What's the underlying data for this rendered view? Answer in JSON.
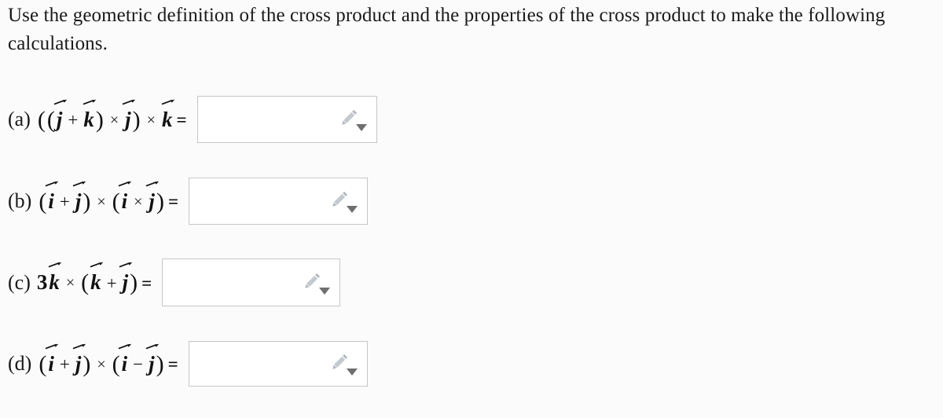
{
  "prompt": {
    "text": "Use the geometric definition of the cross product and the properties of the cross product to make the following calculations."
  },
  "questions": [
    {
      "id": "a",
      "label": "(a)",
      "expression_plain": "((j⃗ + k⃗) × j⃗) × k⃗ =",
      "tokens": [
        {
          "t": "paren",
          "v": "("
        },
        {
          "t": "paren",
          "v": "("
        },
        {
          "t": "vec",
          "v": "j"
        },
        {
          "t": "plus",
          "v": "+"
        },
        {
          "t": "vec",
          "v": "k"
        },
        {
          "t": "paren",
          "v": ")"
        },
        {
          "t": "times",
          "v": "×"
        },
        {
          "t": "vec",
          "v": "j"
        },
        {
          "t": "paren",
          "v": ")"
        },
        {
          "t": "times",
          "v": "×"
        },
        {
          "t": "vec",
          "v": "k"
        },
        {
          "t": "eq",
          "v": "="
        }
      ],
      "answer": {
        "value": "",
        "placeholder": ""
      }
    },
    {
      "id": "b",
      "label": "(b)",
      "expression_plain": "(i⃗ + j⃗) × (i⃗ × j⃗) =",
      "tokens": [
        {
          "t": "paren",
          "v": "("
        },
        {
          "t": "vec",
          "v": "i"
        },
        {
          "t": "plus",
          "v": "+"
        },
        {
          "t": "vec",
          "v": "j"
        },
        {
          "t": "paren",
          "v": ")"
        },
        {
          "t": "times",
          "v": "×"
        },
        {
          "t": "paren",
          "v": "("
        },
        {
          "t": "vec",
          "v": "i"
        },
        {
          "t": "times",
          "v": "×"
        },
        {
          "t": "vec",
          "v": "j"
        },
        {
          "t": "paren",
          "v": ")"
        },
        {
          "t": "eq",
          "v": "="
        }
      ],
      "answer": {
        "value": "",
        "placeholder": ""
      }
    },
    {
      "id": "c",
      "label": "(c)",
      "expression_plain": "3k⃗ × (k⃗ + j⃗) =",
      "tokens": [
        {
          "t": "coef",
          "v": "3"
        },
        {
          "t": "vec",
          "v": "k"
        },
        {
          "t": "times",
          "v": "×"
        },
        {
          "t": "paren",
          "v": "("
        },
        {
          "t": "vec",
          "v": "k"
        },
        {
          "t": "plus",
          "v": "+"
        },
        {
          "t": "vec",
          "v": "j"
        },
        {
          "t": "paren",
          "v": ")"
        },
        {
          "t": "eq",
          "v": "="
        }
      ],
      "answer": {
        "value": "",
        "placeholder": ""
      }
    },
    {
      "id": "d",
      "label": "(d)",
      "expression_plain": "(i⃗ + j⃗) × (i⃗ − j⃗) =",
      "tokens": [
        {
          "t": "paren",
          "v": "("
        },
        {
          "t": "vec",
          "v": "i"
        },
        {
          "t": "plus",
          "v": "+"
        },
        {
          "t": "vec",
          "v": "j"
        },
        {
          "t": "paren",
          "v": ")"
        },
        {
          "t": "times",
          "v": "×"
        },
        {
          "t": "paren",
          "v": "("
        },
        {
          "t": "vec",
          "v": "i"
        },
        {
          "t": "minus",
          "v": "−"
        },
        {
          "t": "vec",
          "v": "j"
        },
        {
          "t": "paren",
          "v": ")"
        },
        {
          "t": "eq",
          "v": "="
        }
      ],
      "answer": {
        "value": "",
        "placeholder": ""
      }
    }
  ],
  "icons": {
    "pencil": "pencil-icon",
    "caret": "chevron-down-icon"
  },
  "colors": {
    "page_background": "#fbfbfb",
    "text": "#1a1a1a",
    "input_background": "#ffffff",
    "input_border": "#c6c6c6",
    "pencil_icon": "#b3b9bf",
    "caret_icon": "#6f6f6f"
  }
}
